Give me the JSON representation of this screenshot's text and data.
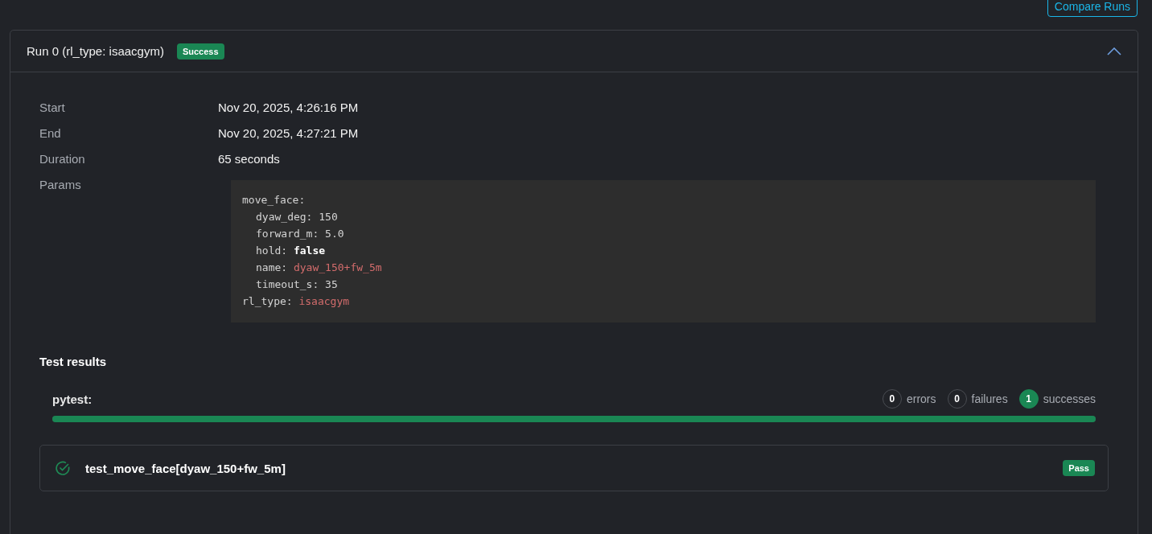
{
  "toolbar": {
    "compare_button": "Compare Runs"
  },
  "run": {
    "title": "Run 0 (rl_type: isaacgym)",
    "status": "Success",
    "expanded": true,
    "details": [
      {
        "label": "Start",
        "value": "Nov 20, 2025, 4:26:16 PM"
      },
      {
        "label": "End",
        "value": "Nov 20, 2025, 4:27:21 PM"
      },
      {
        "label": "Duration",
        "value": "65 seconds"
      }
    ],
    "params_label": "Params",
    "params": [
      {
        "key": "move_face:",
        "children": [
          {
            "key": "dyaw_deg:",
            "value": "150",
            "kind": "number"
          },
          {
            "key": "forward_m:",
            "value": "5.0",
            "kind": "number"
          },
          {
            "key": "hold:",
            "value": "false",
            "kind": "bool"
          },
          {
            "key": "name:",
            "value": "dyaw_150+fw_5m",
            "kind": "string"
          },
          {
            "key": "timeout_s:",
            "value": "35",
            "kind": "number"
          }
        ]
      },
      {
        "key": "rl_type:",
        "value": "isaacgym",
        "kind": "string"
      }
    ],
    "test_results_title": "Test results",
    "suite": {
      "name": "pytest:",
      "level": 1,
      "counts": [
        {
          "count": "0",
          "label": "errors",
          "filled": false
        },
        {
          "count": "0",
          "label": "failures",
          "filled": false
        },
        {
          "count": "1",
          "label": "successes",
          "filled": true
        }
      ]
    },
    "tests": [
      {
        "name": "test_move_face[dyaw_150+fw_5m]",
        "passed": true,
        "result": "Pass"
      }
    ]
  }
}
